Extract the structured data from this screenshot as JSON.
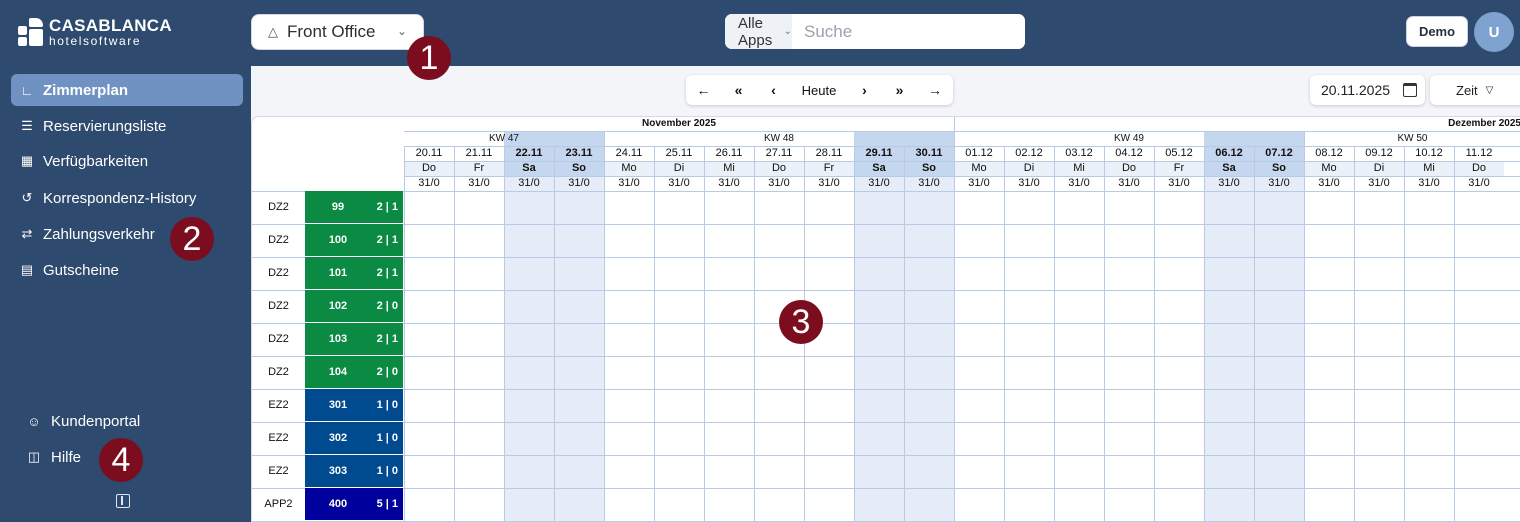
{
  "brand": {
    "name": "CASABLANCA",
    "sub": "hotelsoftware"
  },
  "header": {
    "module_label": "Front Office",
    "apps_label": "Alle Apps",
    "search_placeholder": "Suche",
    "demo_label": "Demo",
    "avatar_initial": "U"
  },
  "sidebar": {
    "items": [
      {
        "label": "Zimmerplan",
        "icon": "chart-icon",
        "active": true
      },
      {
        "label": "Reservierungsliste",
        "icon": "list-icon"
      },
      {
        "label": "Verfügbarkeiten",
        "icon": "calendar-icon"
      },
      {
        "label": "Korrespondenz-History",
        "icon": "history-icon"
      },
      {
        "label": "Zahlungsverkehr",
        "icon": "arrows-icon"
      },
      {
        "label": "Gutscheine",
        "icon": "ticket-icon"
      }
    ],
    "bottom": [
      {
        "label": "Kundenportal",
        "icon": "user-icon"
      },
      {
        "label": "Hilfe",
        "icon": "book-icon"
      }
    ]
  },
  "markers": [
    "1",
    "2",
    "3",
    "4"
  ],
  "toolbar": {
    "today_label": "Heute",
    "date_value": "20.11.2025",
    "view_label": "Zeit"
  },
  "plan": {
    "months": [
      {
        "label": "November 2025",
        "span": 11
      },
      {
        "label": "Dezember 2025",
        "span": 4
      }
    ],
    "weeks": [
      {
        "label": "KW 47",
        "span": 4
      },
      {
        "label": "KW 48",
        "span": 7
      },
      {
        "label": "KW 49",
        "span": 7
      },
      {
        "label": "KW 50",
        "span": 4
      }
    ],
    "days": [
      {
        "date": "20.11",
        "dow": "Do",
        "avail": "31/0",
        "weekend": false
      },
      {
        "date": "21.11",
        "dow": "Fr",
        "avail": "31/0",
        "weekend": false
      },
      {
        "date": "22.11",
        "dow": "Sa",
        "avail": "31/0",
        "weekend": true
      },
      {
        "date": "23.11",
        "dow": "So",
        "avail": "31/0",
        "weekend": true
      },
      {
        "date": "24.11",
        "dow": "Mo",
        "avail": "31/0",
        "weekend": false
      },
      {
        "date": "25.11",
        "dow": "Di",
        "avail": "31/0",
        "weekend": false
      },
      {
        "date": "26.11",
        "dow": "Mi",
        "avail": "31/0",
        "weekend": false
      },
      {
        "date": "27.11",
        "dow": "Do",
        "avail": "31/0",
        "weekend": false
      },
      {
        "date": "28.11",
        "dow": "Fr",
        "avail": "31/0",
        "weekend": false
      },
      {
        "date": "29.11",
        "dow": "Sa",
        "avail": "31/0",
        "weekend": true
      },
      {
        "date": "30.11",
        "dow": "So",
        "avail": "31/0",
        "weekend": true
      },
      {
        "date": "01.12",
        "dow": "Mo",
        "avail": "31/0",
        "weekend": false
      },
      {
        "date": "02.12",
        "dow": "Di",
        "avail": "31/0",
        "weekend": false
      },
      {
        "date": "03.12",
        "dow": "Mi",
        "avail": "31/0",
        "weekend": false
      },
      {
        "date": "04.12",
        "dow": "Do",
        "avail": "31/0",
        "weekend": false
      },
      {
        "date": "05.12",
        "dow": "Fr",
        "avail": "31/0",
        "weekend": false
      },
      {
        "date": "06.12",
        "dow": "Sa",
        "avail": "31/0",
        "weekend": true
      },
      {
        "date": "07.12",
        "dow": "So",
        "avail": "31/0",
        "weekend": true
      },
      {
        "date": "08.12",
        "dow": "Mo",
        "avail": "31/0",
        "weekend": false
      },
      {
        "date": "09.12",
        "dow": "Di",
        "avail": "31/0",
        "weekend": false
      },
      {
        "date": "10.12",
        "dow": "Mi",
        "avail": "31/0",
        "weekend": false
      },
      {
        "date": "11.12",
        "dow": "Do",
        "avail": "31/0",
        "weekend": false
      }
    ],
    "rooms": [
      {
        "type": "DZ2",
        "number": "99",
        "occ": "2 | 1",
        "color": "#0a8a43"
      },
      {
        "type": "DZ2",
        "number": "100",
        "occ": "2 | 1",
        "color": "#0a8a43"
      },
      {
        "type": "DZ2",
        "number": "101",
        "occ": "2 | 1",
        "color": "#0a8a43"
      },
      {
        "type": "DZ2",
        "number": "102",
        "occ": "2 | 0",
        "color": "#0a8a43"
      },
      {
        "type": "DZ2",
        "number": "103",
        "occ": "2 | 1",
        "color": "#0a8a43"
      },
      {
        "type": "DZ2",
        "number": "104",
        "occ": "2 | 0",
        "color": "#0a8a43"
      },
      {
        "type": "EZ2",
        "number": "301",
        "occ": "1 | 0",
        "color": "#004a8f"
      },
      {
        "type": "EZ2",
        "number": "302",
        "occ": "1 | 0",
        "color": "#004a8f"
      },
      {
        "type": "EZ2",
        "number": "303",
        "occ": "1 | 0",
        "color": "#004a8f"
      },
      {
        "type": "APP2",
        "number": "400",
        "occ": "5 | 1",
        "color": "#00009c"
      }
    ],
    "colors": {
      "weekend": "#e6edf8",
      "weekend_header": "#c5d7ef",
      "grid": "#b7cbe6"
    }
  }
}
